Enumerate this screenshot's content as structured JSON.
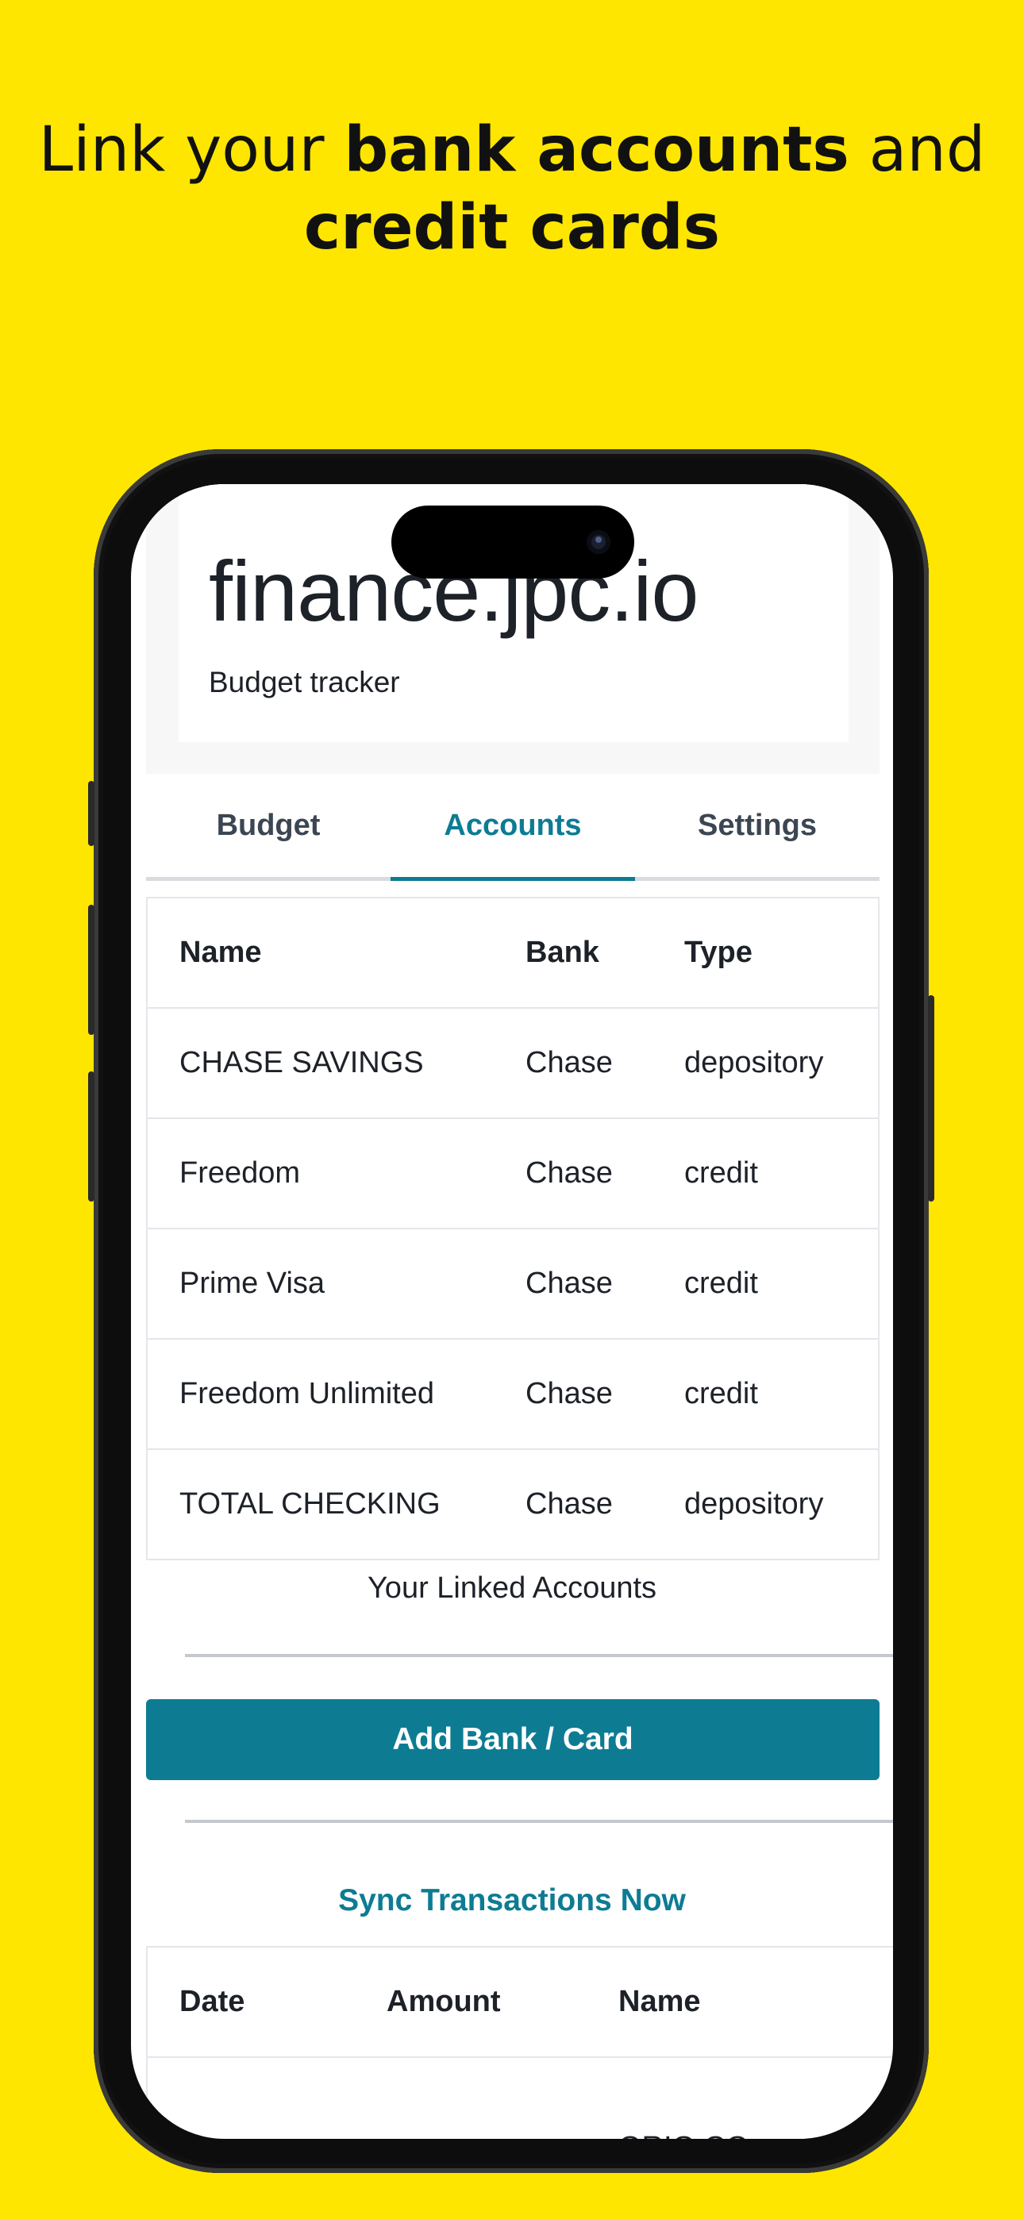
{
  "headline": {
    "part1": "Link your ",
    "bold1": "bank accounts",
    "part2": " and",
    "bold2": "credit cards"
  },
  "app": {
    "title": "finance.jpc.io",
    "subtitle": "Budget tracker"
  },
  "tabs": [
    {
      "label": "Budget",
      "active": false
    },
    {
      "label": "Accounts",
      "active": true
    },
    {
      "label": "Settings",
      "active": false
    }
  ],
  "accounts_table": {
    "headers": [
      "Name",
      "Bank",
      "Type"
    ],
    "rows": [
      [
        "CHASE SAVINGS",
        "Chase",
        "depository"
      ],
      [
        "Freedom",
        "Chase",
        "credit"
      ],
      [
        "Prime Visa",
        "Chase",
        "credit"
      ],
      [
        "Freedom Unlimited",
        "Chase",
        "credit"
      ],
      [
        "TOTAL CHECKING",
        "Chase",
        "depository"
      ]
    ],
    "caption": "Your Linked Accounts"
  },
  "add_button_label": "Add Bank / Card",
  "sync_link_label": "Sync Transactions Now",
  "transactions_table": {
    "headers": [
      "Date",
      "Amount",
      "Name"
    ],
    "rows": [
      [
        "",
        "",
        "ORIG CO"
      ]
    ]
  },
  "colors": {
    "background": "#FFE600",
    "accent": "#0d7c93",
    "text": "#1d2128"
  }
}
